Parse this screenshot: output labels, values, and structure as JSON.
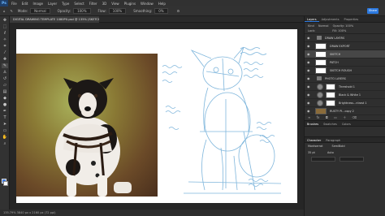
{
  "menu": {
    "app_logo": "Ps",
    "items": [
      "File",
      "Edit",
      "Image",
      "Layer",
      "Type",
      "Select",
      "Filter",
      "3D",
      "View",
      "Plugins",
      "Window",
      "Help"
    ]
  },
  "options": {
    "mode_label": "Mode:",
    "mode_value": "Normal",
    "opacity_label": "Opacity:",
    "opacity_value": "100%",
    "flow_label": "Flow:",
    "flow_value": "100%",
    "smoothing_label": "Smoothing:",
    "smoothing_value": "0%",
    "share_label": "Share"
  },
  "document": {
    "tab_title": "DIGITAL DRAWING TEMPLATE 1080PX.psd @ 135% (SKETCH, RGB/8#)",
    "status": "135.79%   3840 px x 2160 px (72 ppi)"
  },
  "panels": {
    "tabs": [
      "Layers",
      "Adjustments",
      "Properties"
    ],
    "kind_label": "Kind",
    "blend_mode": "Normal",
    "opacity_label": "Opacity: 100%",
    "lock_label": "Lock:",
    "fill_label": "Fill: 100%",
    "layers": [
      {
        "name": "DRAW LAYERS",
        "type": "group"
      },
      {
        "name": "DRAW EXPORT",
        "type": "layer"
      },
      {
        "name": "SKETCH",
        "type": "layer",
        "selected": true
      },
      {
        "name": "PATCH",
        "type": "layer"
      },
      {
        "name": "SKETCH ROUGH",
        "type": "layer"
      },
      {
        "name": "PHOTO LAYERS",
        "type": "group"
      },
      {
        "name": "Threshold 1",
        "type": "adjustment"
      },
      {
        "name": "Black & White 1",
        "type": "adjustment"
      },
      {
        "name": "Brightness...ntrast 1",
        "type": "adjustment"
      },
      {
        "name": "RUSTY PI...copy 2",
        "type": "layer"
      }
    ],
    "bottom_tabs": [
      "Brushes",
      "Swatches",
      "Colors"
    ],
    "char_tabs": [
      "Character",
      "Paragraph"
    ],
    "font_family": "Montserrat",
    "font_style": "SemiBold",
    "font_size": "35 pt",
    "leading": "Auto"
  },
  "colors": {
    "accent": "#2d7ae0",
    "foreground": "#3f7ae0",
    "background": "#ffffff",
    "sketch_stroke": "#7fb6dc"
  },
  "icons": {
    "tools": [
      "move-icon",
      "marquee-icon",
      "lasso-icon",
      "quick-select-icon",
      "crop-icon",
      "eyedropper-icon",
      "heal-icon",
      "brush-icon",
      "stamp-icon",
      "history-brush-icon",
      "eraser-icon",
      "gradient-icon",
      "blur-icon",
      "dodge-icon",
      "pen-icon",
      "type-icon",
      "path-select-icon",
      "shape-icon",
      "hand-icon",
      "zoom-icon"
    ]
  }
}
